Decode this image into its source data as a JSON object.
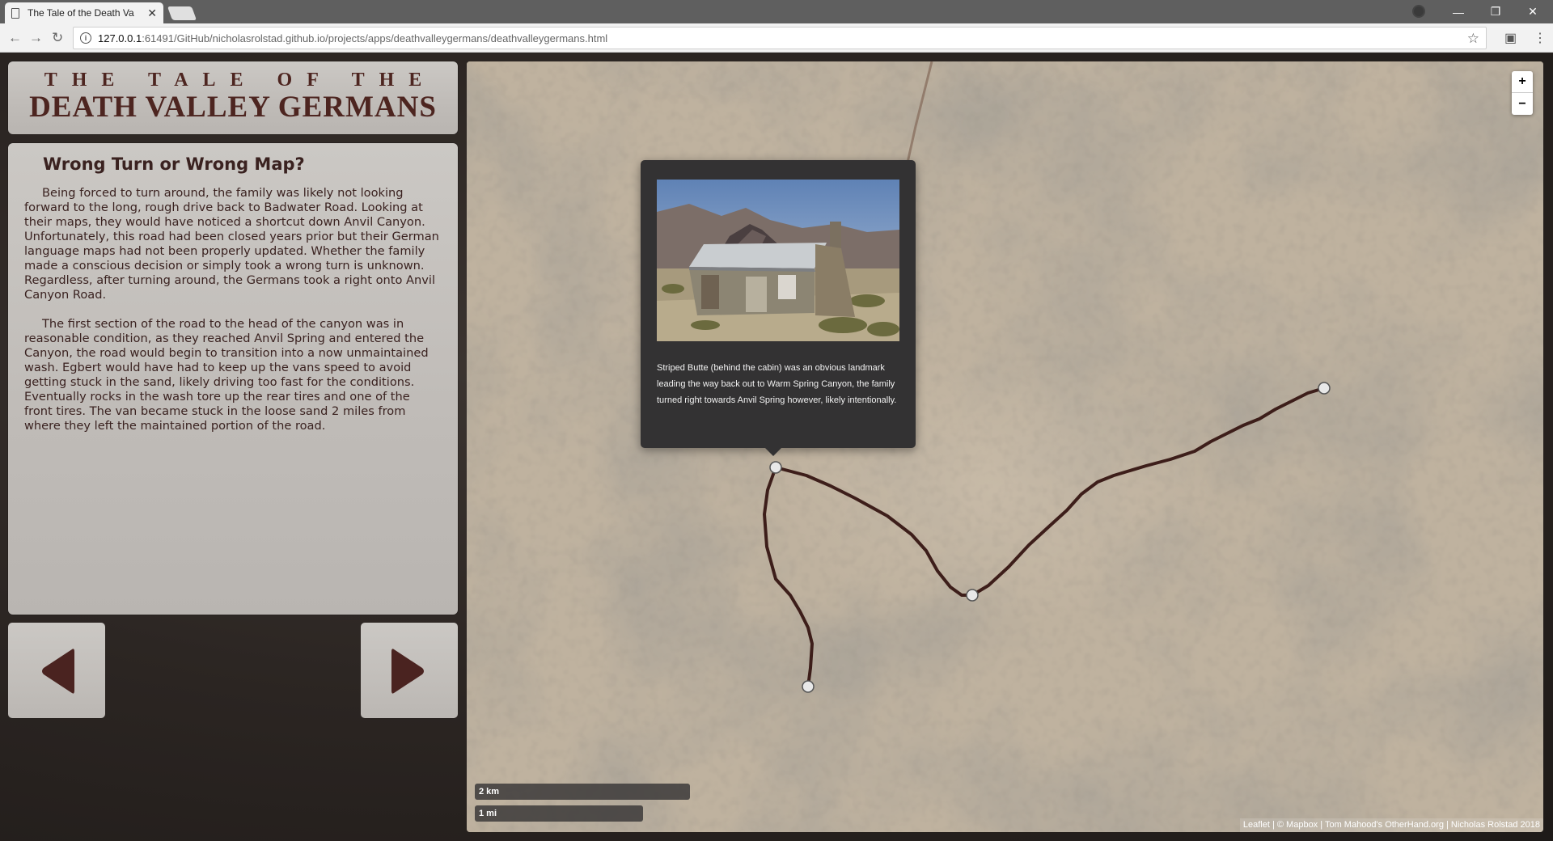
{
  "browser": {
    "tab_title": "The Tale of the Death Va",
    "tab_close": "✕",
    "url_host": "127.0.0.1",
    "url_rest": ":61491/GitHub/nicholasrolstad.github.io/projects/apps/deathvalleygermans/deathvalleygermans.html",
    "window_controls": [
      "—",
      "❐",
      "✕"
    ]
  },
  "header": {
    "title_small": "THE TALE OF THE",
    "title_big": "DEATH VALLEY GERMANS"
  },
  "story": {
    "title": "Wrong Turn or Wrong Map?",
    "paragraphs": [
      "Being forced to turn around, the family was likely not looking forward to the long, rough drive back to Badwater Road. Looking at their maps, they would have noticed a shortcut down Anvil Canyon. Unfortunately, this road had been closed years prior but their German language maps had not been properly updated. Whether the family made a conscious decision or simply took a wrong turn is unknown. Regardless, after turning around, the Germans took a right onto Anvil Canyon Road.",
      "The first section of the road to the head of the canyon was in reasonable condition, as they reached Anvil Spring and entered the Canyon, the road would begin to transition into a now unmaintained wash. Egbert would have had to keep up the vans speed to avoid getting stuck in the sand, likely driving too fast for the conditions. Eventually rocks in the wash tore up the rear tires and one of the front tires. The van became stuck in the loose sand 2 miles from where they left the maintained portion of the road."
    ]
  },
  "navigation": {
    "prev_icon": "left-triangle-icon",
    "next_icon": "right-triangle-icon"
  },
  "map": {
    "zoom_in": "+",
    "zoom_out": "−",
    "popup_text": "Striped Butte (behind the cabin) was an obvious landmark leading the way back out to Warm Spring Canyon, the family turned right towards Anvil Spring however, likely intentionally.",
    "scale_km": "2 km",
    "scale_mi": "1 mi",
    "attribution": "Leaflet | © Mapbox | Tom Mahood's OtherHand.org | Nicholas Rolstad 2018",
    "route_color": "#3d1e1a",
    "marker_color": "#e8e8e8"
  }
}
